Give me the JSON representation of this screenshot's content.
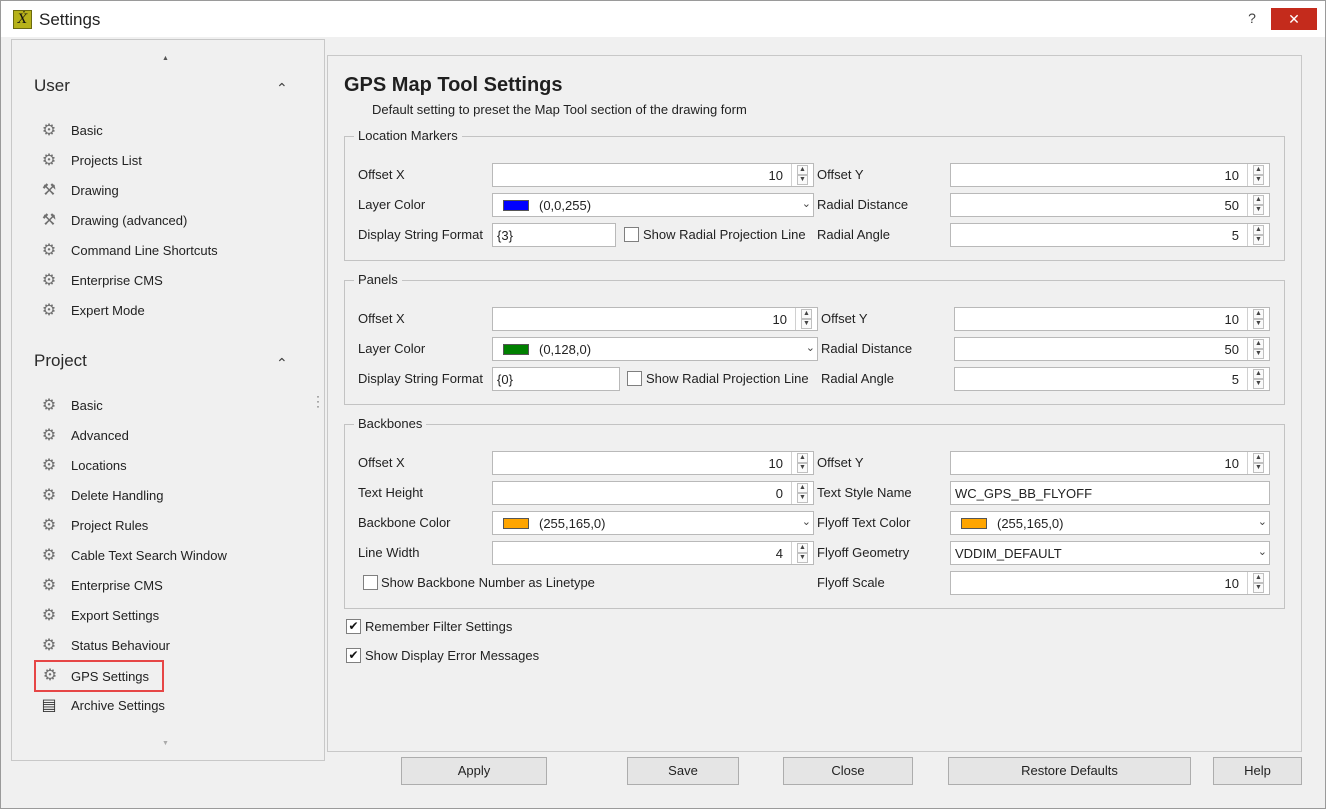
{
  "window": {
    "title": "Settings",
    "help_label": "?",
    "close_label": "✕",
    "app_icon_glyph": "Ẋ",
    "app_icon_name": "xl-app-icon"
  },
  "sidebar": {
    "scroll_up": "▲",
    "scroll_down": "▼",
    "more_menu": "⋮",
    "user_section": {
      "title": "User",
      "chevron": "⌃",
      "items": [
        {
          "label": "Basic",
          "icon": "gear-icon"
        },
        {
          "label": "Projects List",
          "icon": "gear-icon"
        },
        {
          "label": "Drawing",
          "icon": "wrench-icon"
        },
        {
          "label": "Drawing (advanced)",
          "icon": "wrench-icon"
        },
        {
          "label": "Command Line Shortcuts",
          "icon": "gear-icon"
        },
        {
          "label": "Enterprise CMS",
          "icon": "gear-icon"
        },
        {
          "label": "Expert Mode",
          "icon": "gear-icon"
        }
      ]
    },
    "project_section": {
      "title": "Project",
      "chevron": "⌃",
      "items": [
        {
          "label": "Basic",
          "icon": "gear-icon"
        },
        {
          "label": "Advanced",
          "icon": "gear-icon"
        },
        {
          "label": "Locations",
          "icon": "gear-icon"
        },
        {
          "label": "Delete Handling",
          "icon": "gear-icon"
        },
        {
          "label": "Project Rules",
          "icon": "gear-icon"
        },
        {
          "label": "Cable Text Search Window",
          "icon": "gear-icon"
        },
        {
          "label": "Enterprise CMS",
          "icon": "gear-icon"
        },
        {
          "label": "Export Settings",
          "icon": "gear-icon"
        },
        {
          "label": "Status Behaviour",
          "icon": "gear-icon"
        },
        {
          "label": "GPS Settings",
          "icon": "gear-icon",
          "selected": true
        },
        {
          "label": "Archive Settings",
          "icon": "archive-icon"
        }
      ]
    }
  },
  "main": {
    "title": "GPS Map Tool Settings",
    "subtitle": "Default setting to preset the Map Tool section of the drawing form",
    "location_markers": {
      "title": "Location Markers",
      "offset_x_label": "Offset X",
      "offset_x": "10",
      "offset_y_label": "Offset Y",
      "offset_y": "10",
      "layer_color_label": "Layer Color",
      "layer_color_text": "(0,0,255)",
      "layer_color_hex": "#0000ff",
      "radial_distance_label": "Radial Distance",
      "radial_distance": "50",
      "display_format_label": "Display String Format",
      "display_format": "{3}",
      "show_radial_label": "Show Radial Projection Line",
      "show_radial_checked": false,
      "radial_angle_label": "Radial Angle",
      "radial_angle": "5"
    },
    "panels": {
      "title": "Panels",
      "offset_x_label": "Offset X",
      "offset_x": "10",
      "offset_y_label": "Offset Y",
      "offset_y": "10",
      "layer_color_label": "Layer Color",
      "layer_color_text": "(0,128,0)",
      "layer_color_hex": "#008000",
      "radial_distance_label": "Radial Distance",
      "radial_distance": "50",
      "display_format_label": "Display String Format",
      "display_format": "{0}",
      "show_radial_label": "Show Radial Projection Line",
      "show_radial_checked": false,
      "radial_angle_label": "Radial Angle",
      "radial_angle": "5"
    },
    "backbones": {
      "title": "Backbones",
      "offset_x_label": "Offset X",
      "offset_x": "10",
      "offset_y_label": "Offset Y",
      "offset_y": "10",
      "text_height_label": "Text Height",
      "text_height": "0",
      "text_style_label": "Text Style Name",
      "text_style": "WC_GPS_BB_FLYOFF",
      "backbone_color_label": "Backbone Color",
      "backbone_color_text": "(255,165,0)",
      "backbone_color_hex": "#ffa500",
      "flyoff_text_color_label": "Flyoff Text Color",
      "flyoff_text_color_text": "(255,165,0)",
      "flyoff_text_color_hex": "#ffa500",
      "line_width_label": "Line Width",
      "line_width": "4",
      "flyoff_geometry_label": "Flyoff Geometry",
      "flyoff_geometry": "VDDIM_DEFAULT",
      "show_backbone_label": "Show Backbone Number as Linetype",
      "show_backbone_checked": false,
      "flyoff_scale_label": "Flyoff Scale",
      "flyoff_scale": "10"
    },
    "remember_filter_label": "Remember Filter Settings",
    "remember_filter_checked": true,
    "show_errors_label": "Show Display Error Messages",
    "show_errors_checked": true
  },
  "buttons": {
    "apply": "Apply",
    "save": "Save",
    "close": "Close",
    "restore": "Restore Defaults",
    "help": "Help"
  },
  "glyphs": {
    "check": "✔",
    "spin_up": "▲",
    "spin_down": "▼",
    "dropdown": "⌄"
  }
}
